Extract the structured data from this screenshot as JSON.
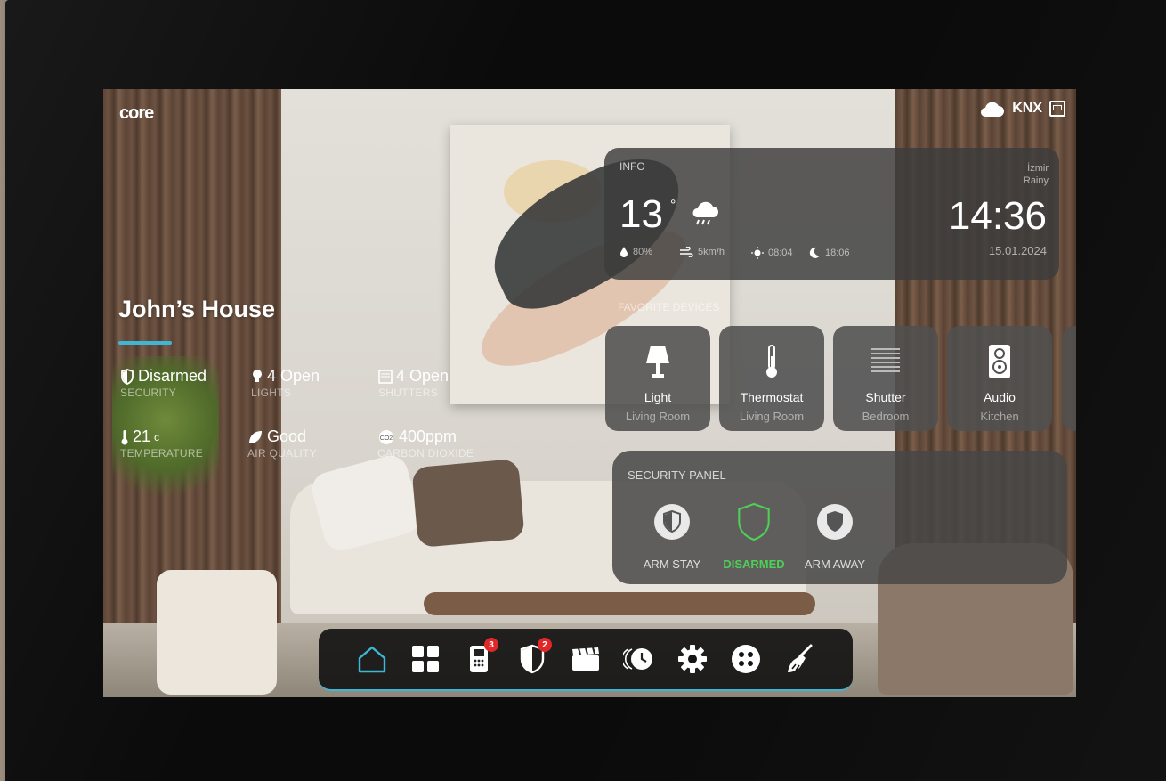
{
  "brand": {
    "logo": "core"
  },
  "header": {
    "protocol": "KNX"
  },
  "house": {
    "title": "John’s House"
  },
  "stats": [
    {
      "value": "Disarmed",
      "label": "SECURITY"
    },
    {
      "value": "4 Open",
      "label": "LIGHTS"
    },
    {
      "value": "4 Open",
      "label": "SHUTTERS"
    },
    {
      "value": "21",
      "unit": "c",
      "label": "TEMPERATURE"
    },
    {
      "value": "Good",
      "label": "AIR QUALITY"
    },
    {
      "value": "400ppm",
      "label": "CARBON DIOXIDE"
    }
  ],
  "info": {
    "label": "INFO",
    "temperature": "13",
    "degree": "°",
    "humidity": "80%",
    "wind": "5km/h",
    "sunrise": "08:04",
    "sunset": "18:06",
    "city": "İzmir",
    "condition": "Rainy",
    "time": "14:36",
    "date": "15.01.2024"
  },
  "favorites": {
    "label": "FAVORITE DEVICES",
    "items": [
      {
        "name": "Light",
        "room": "Living Room",
        "icon": "lamp-icon"
      },
      {
        "name": "Thermostat",
        "room": "Living Room",
        "icon": "thermometer-icon"
      },
      {
        "name": "Shutter",
        "room": "Bedroom",
        "icon": "shutter-icon"
      },
      {
        "name": "Audio",
        "room": "Kitchen",
        "icon": "speaker-icon"
      }
    ]
  },
  "security_panel": {
    "title": "SECURITY PANEL",
    "options": [
      {
        "label": "ARM STAY"
      },
      {
        "label": "DISARMED"
      },
      {
        "label": "ARM AWAY"
      }
    ],
    "active": "DISARMED",
    "active_color": "#4ecf56"
  },
  "nav": {
    "items": [
      {
        "icon": "home-icon"
      },
      {
        "icon": "rooms-grid-icon"
      },
      {
        "icon": "intercom-icon",
        "badge": "3"
      },
      {
        "icon": "security-shield-icon",
        "badge": "2"
      },
      {
        "icon": "scenes-clapper-icon"
      },
      {
        "icon": "schedule-clock-icon"
      },
      {
        "icon": "settings-gear-icon"
      },
      {
        "icon": "more-dots-icon"
      },
      {
        "icon": "cleaning-icon"
      }
    ],
    "accent": "#3eb6d6"
  }
}
